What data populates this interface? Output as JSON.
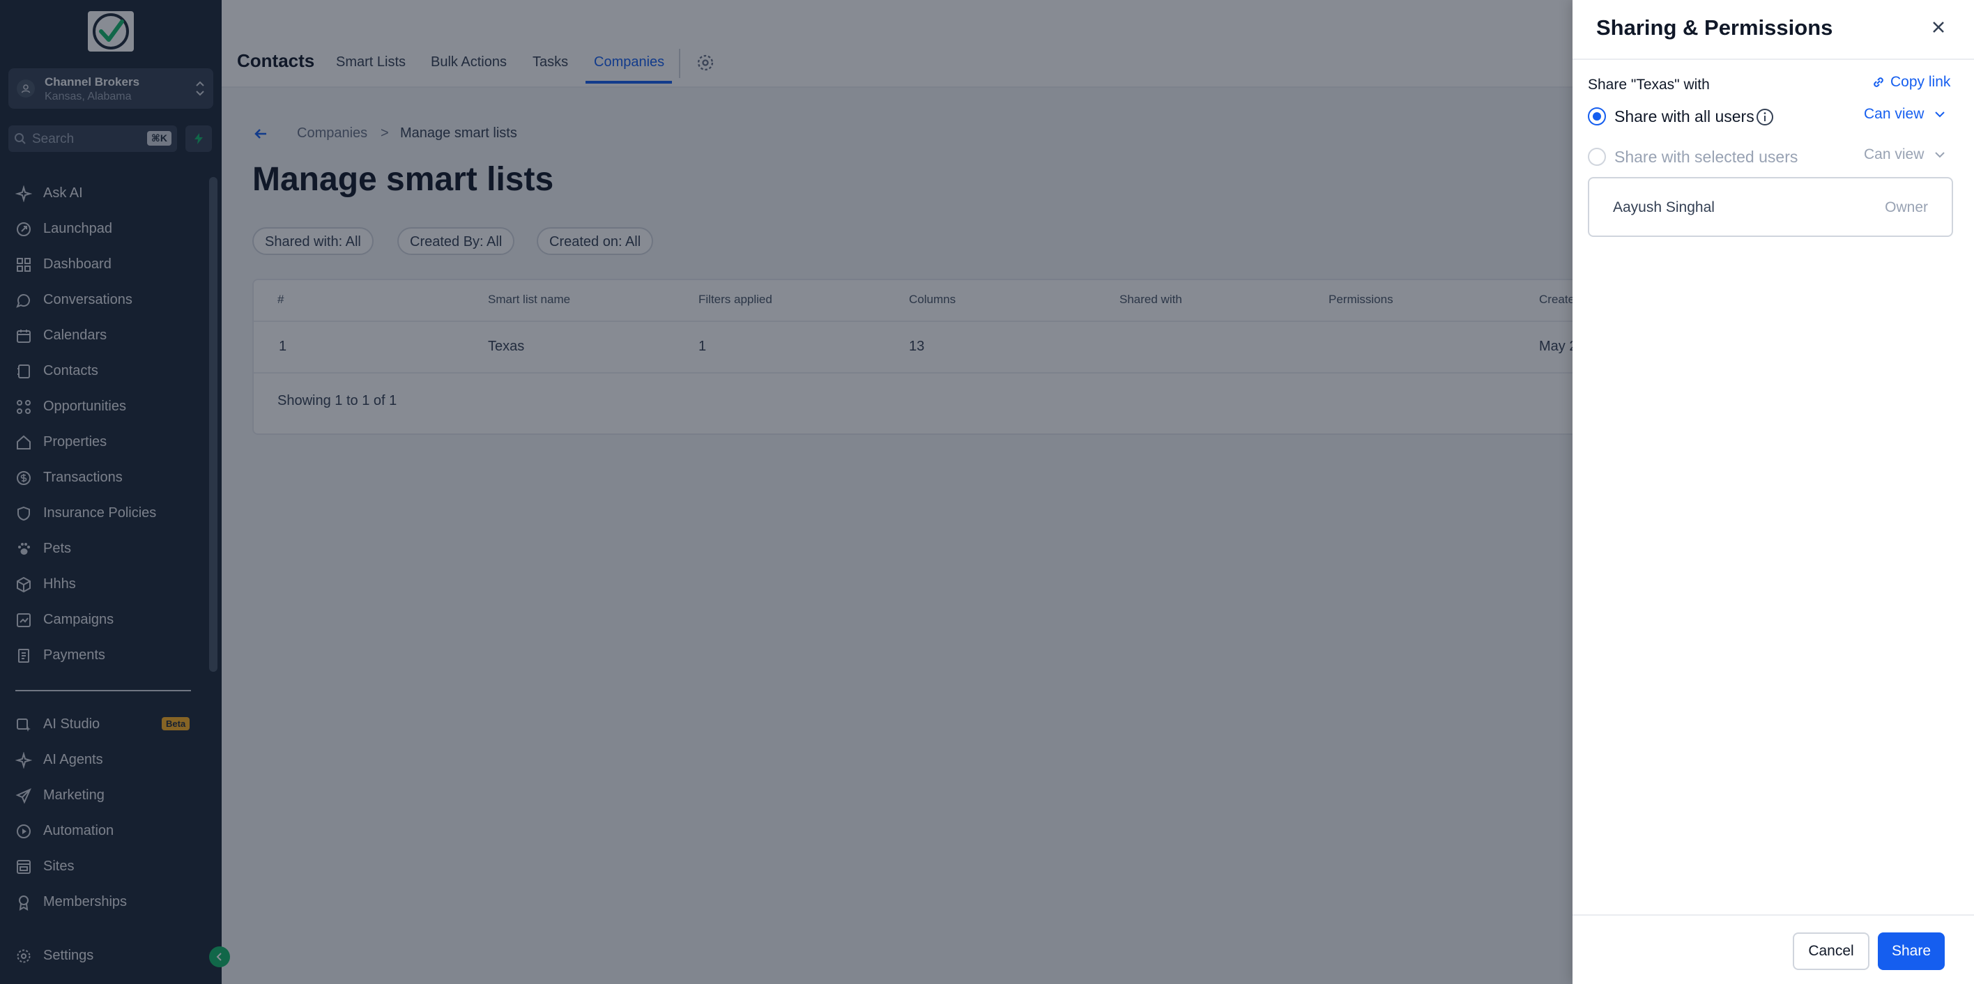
{
  "sidebar": {
    "account": {
      "name": "Channel Brokers",
      "location": "Kansas, Alabama"
    },
    "search": {
      "placeholder": "Search",
      "shortcut": "⌘K"
    },
    "items": [
      {
        "label": "Ask AI",
        "icon": "sparkle-icon"
      },
      {
        "label": "Launchpad",
        "icon": "rocket-icon"
      },
      {
        "label": "Dashboard",
        "icon": "dashboard-icon"
      },
      {
        "label": "Conversations",
        "icon": "chat-icon"
      },
      {
        "label": "Calendars",
        "icon": "calendar-icon"
      },
      {
        "label": "Contacts",
        "icon": "contacts-icon"
      },
      {
        "label": "Opportunities",
        "icon": "opportunities-icon"
      },
      {
        "label": "Properties",
        "icon": "home-icon"
      },
      {
        "label": "Transactions",
        "icon": "dollar-icon"
      },
      {
        "label": "Insurance Policies",
        "icon": "shield-icon"
      },
      {
        "label": "Pets",
        "icon": "paw-icon"
      },
      {
        "label": "Hhhs",
        "icon": "box-icon"
      },
      {
        "label": "Campaigns",
        "icon": "campaign-icon"
      },
      {
        "label": "Payments",
        "icon": "invoice-icon"
      }
    ],
    "secondary": [
      {
        "label": "AI Studio",
        "icon": "ai-studio-icon",
        "badge": "Beta"
      },
      {
        "label": "AI Agents",
        "icon": "sparkle-icon"
      },
      {
        "label": "Marketing",
        "icon": "send-icon"
      },
      {
        "label": "Automation",
        "icon": "automation-icon"
      },
      {
        "label": "Sites",
        "icon": "sites-icon"
      },
      {
        "label": "Memberships",
        "icon": "award-icon"
      }
    ],
    "settings_label": "Settings"
  },
  "header": {
    "title": "Contacts",
    "tabs": [
      "Smart Lists",
      "Bulk Actions",
      "Tasks",
      "Companies"
    ],
    "active_tab": "Companies"
  },
  "breadcrumb": {
    "parent": "Companies",
    "separator": ">",
    "current": "Manage smart lists"
  },
  "page_title": "Manage smart lists",
  "filters": [
    "Shared with: All",
    "Created By: All",
    "Created on: All"
  ],
  "table": {
    "columns": [
      "#",
      "Smart list name",
      "Filters applied",
      "Columns",
      "Shared with",
      "Permissions",
      "Create"
    ],
    "rows": [
      {
        "num": "1",
        "name": "Texas",
        "filters": "1",
        "columns": "13",
        "shared": "",
        "permissions": "",
        "created": "May 2"
      }
    ],
    "footer": "Showing 1 to 1 of 1"
  },
  "drawer": {
    "title": "Sharing & Permissions",
    "share_label": "Share \"Texas\" with",
    "copy_link": "Copy link",
    "options": [
      {
        "label": "Share with all users",
        "permission": "Can view",
        "selected": true
      },
      {
        "label": "Share with selected users",
        "permission": "Can view",
        "selected": false
      }
    ],
    "users": [
      {
        "name": "Aayush Singhal",
        "role": "Owner"
      }
    ],
    "cancel": "Cancel",
    "share": "Share"
  },
  "colors": {
    "accent": "#155eef",
    "sidebar": "#1d2939",
    "success": "#12b76a"
  }
}
